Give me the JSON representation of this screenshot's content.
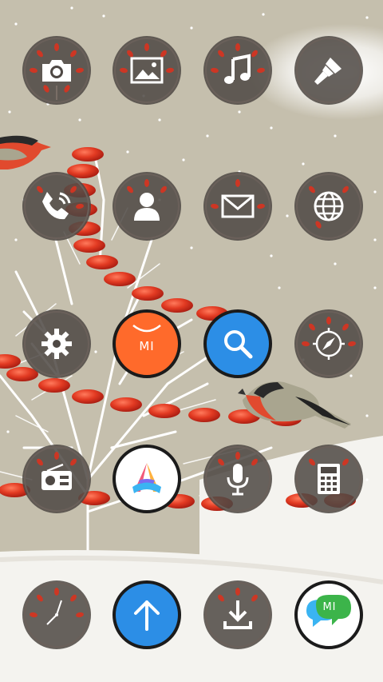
{
  "home_screen": {
    "rows": [
      [
        {
          "name": "camera",
          "icon": "camera-icon"
        },
        {
          "name": "gallery",
          "icon": "image-icon"
        },
        {
          "name": "music",
          "icon": "music-note-icon"
        },
        {
          "name": "themes",
          "icon": "paintbrush-icon"
        }
      ],
      [
        {
          "name": "phone",
          "icon": "phone-icon"
        },
        {
          "name": "contacts",
          "icon": "person-icon"
        },
        {
          "name": "messages",
          "icon": "envelope-icon"
        },
        {
          "name": "browser",
          "icon": "globe-icon"
        }
      ],
      [
        {
          "name": "settings",
          "icon": "gear-icon"
        },
        {
          "name": "mi-store",
          "icon": "mi-bag-icon",
          "text": "MI"
        },
        {
          "name": "search",
          "icon": "search-icon"
        },
        {
          "name": "compass",
          "icon": "compass-icon"
        }
      ],
      [
        {
          "name": "fm-radio",
          "icon": "radio-icon"
        },
        {
          "name": "app-vault",
          "icon": "a-logo-icon"
        },
        {
          "name": "recorder",
          "icon": "microphone-icon"
        },
        {
          "name": "calculator",
          "icon": "calculator-icon"
        }
      ],
      [
        {
          "name": "clock",
          "icon": "clock-icon"
        },
        {
          "name": "updater",
          "icon": "arrow-up-icon"
        },
        {
          "name": "downloads",
          "icon": "download-icon"
        },
        {
          "name": "mi-talk",
          "icon": "mi-chat-icon",
          "text": "MI"
        }
      ]
    ]
  },
  "colors": {
    "wallpaper": "#c5bfad",
    "snow": "#f4f3ef",
    "berry": "#d9331f",
    "themed_icon_bg": "#4e4844",
    "mi_orange": "#ff6a2b",
    "search_blue": "#2c8ee6",
    "mi_green": "#3cb44a"
  }
}
